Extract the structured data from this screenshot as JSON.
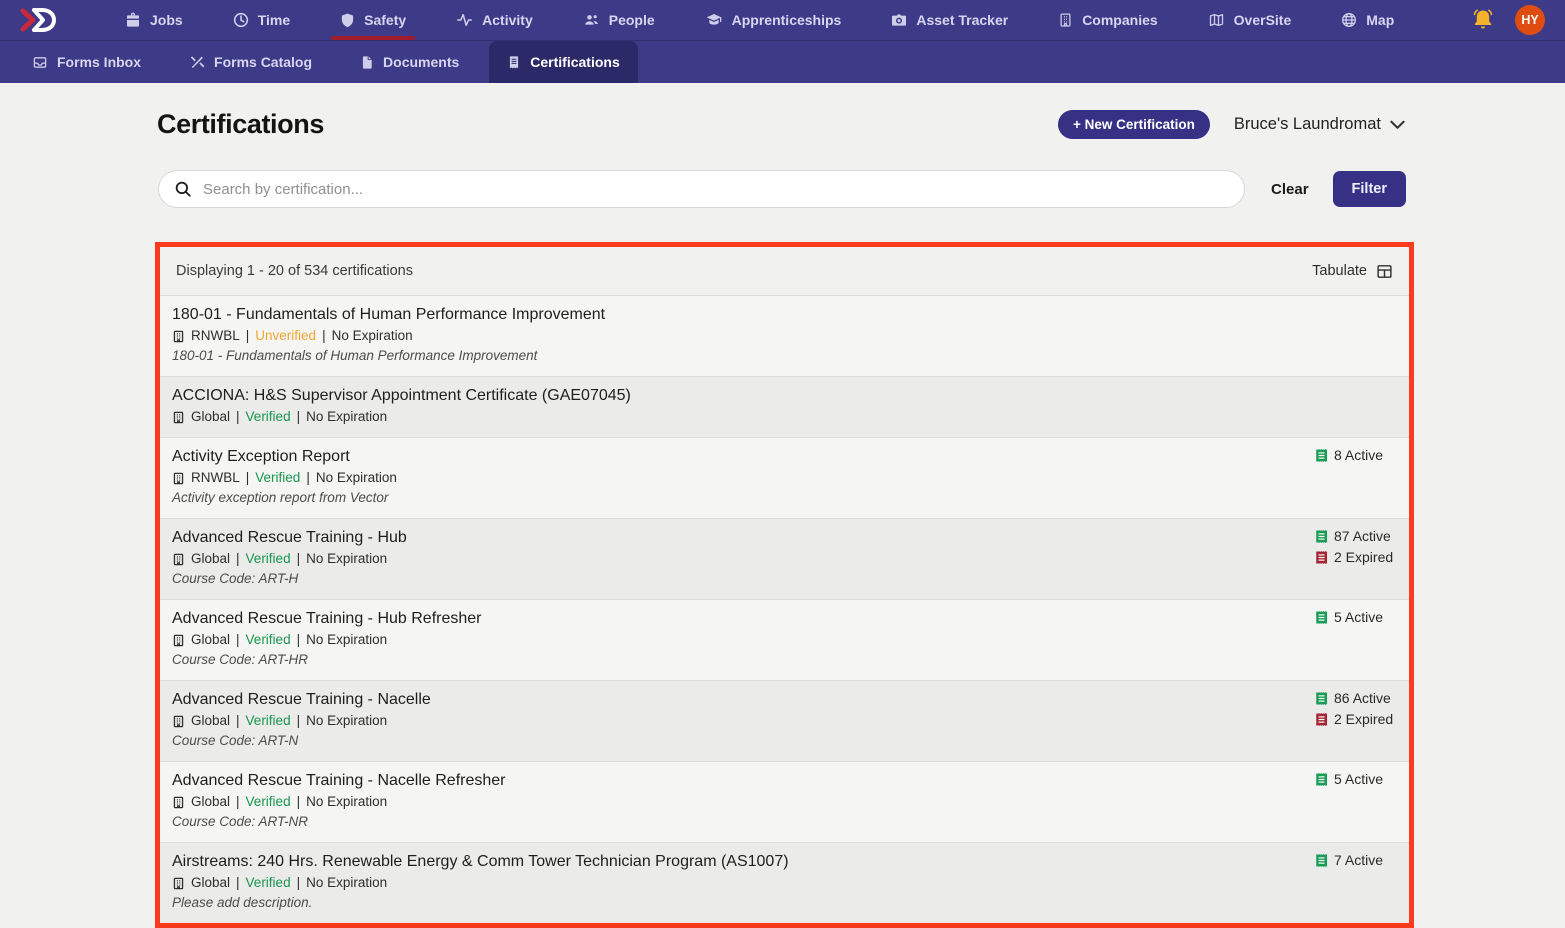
{
  "brand": {
    "logo": "arrow-d-logo"
  },
  "top_nav": {
    "items": [
      {
        "label": "Jobs",
        "icon": "briefcase-icon",
        "active": false
      },
      {
        "label": "Time",
        "icon": "clock-icon",
        "active": false
      },
      {
        "label": "Safety",
        "icon": "shield-icon",
        "active": true
      },
      {
        "label": "Activity",
        "icon": "pulse-icon",
        "active": false
      },
      {
        "label": "People",
        "icon": "people-icon",
        "active": false
      },
      {
        "label": "Apprenticeships",
        "icon": "graduation-cap-icon",
        "active": false
      },
      {
        "label": "Asset Tracker",
        "icon": "camera-icon",
        "active": false
      },
      {
        "label": "Companies",
        "icon": "building-icon",
        "active": false
      },
      {
        "label": "OverSite",
        "icon": "map-icon",
        "active": false
      },
      {
        "label": "Map",
        "icon": "globe-icon",
        "active": false
      }
    ],
    "avatar_initials": "HY"
  },
  "sub_nav": {
    "items": [
      {
        "label": "Forms Inbox",
        "icon": "inbox-icon",
        "active": false
      },
      {
        "label": "Forms Catalog",
        "icon": "tools-icon",
        "active": false
      },
      {
        "label": "Documents",
        "icon": "document-icon",
        "active": false
      },
      {
        "label": "Certifications",
        "icon": "certificate-icon",
        "active": true
      }
    ]
  },
  "page": {
    "title": "Certifications",
    "new_button_label": "+ New Certification",
    "company_selector": "Bruce's Laundromat"
  },
  "search": {
    "placeholder": "Search by certification...",
    "clear_label": "Clear",
    "filter_label": "Filter"
  },
  "list": {
    "summary": "Displaying 1 - 20 of 534 certifications",
    "tabulate_label": "Tabulate",
    "meta_separator": "|",
    "rows": [
      {
        "title": "180-01 - Fundamentals of Human Performance Improvement",
        "scope": "RNWBL",
        "status": "Unverified",
        "expiration": "No Expiration",
        "description": "180-01 - Fundamentals of Human Performance Improvement",
        "counts": []
      },
      {
        "title": "ACCIONA: H&S Supervisor Appointment Certificate (GAE07045)",
        "scope": "Global",
        "status": "Verified",
        "expiration": "No Expiration",
        "description": null,
        "counts": []
      },
      {
        "title": "Activity Exception Report",
        "scope": "RNWBL",
        "status": "Verified",
        "expiration": "No Expiration",
        "description": "Activity exception report from Vector",
        "counts": [
          {
            "kind": "active",
            "text": "8 Active"
          }
        ]
      },
      {
        "title": "Advanced Rescue Training - Hub",
        "scope": "Global",
        "status": "Verified",
        "expiration": "No Expiration",
        "description": "Course Code: ART-H",
        "counts": [
          {
            "kind": "active",
            "text": "87 Active"
          },
          {
            "kind": "expired",
            "text": "2 Expired"
          }
        ]
      },
      {
        "title": "Advanced Rescue Training - Hub Refresher",
        "scope": "Global",
        "status": "Verified",
        "expiration": "No Expiration",
        "description": "Course Code: ART-HR",
        "counts": [
          {
            "kind": "active",
            "text": "5 Active"
          }
        ]
      },
      {
        "title": "Advanced Rescue Training - Nacelle",
        "scope": "Global",
        "status": "Verified",
        "expiration": "No Expiration",
        "description": "Course Code: ART-N",
        "counts": [
          {
            "kind": "active",
            "text": "86 Active"
          },
          {
            "kind": "expired",
            "text": "2 Expired"
          }
        ]
      },
      {
        "title": "Advanced Rescue Training - Nacelle Refresher",
        "scope": "Global",
        "status": "Verified",
        "expiration": "No Expiration",
        "description": "Course Code: ART-NR",
        "counts": [
          {
            "kind": "active",
            "text": "5 Active"
          }
        ]
      },
      {
        "title": "Airstreams: 240 Hrs. Renewable Energy & Comm Tower Technician Program (AS1007)",
        "scope": "Global",
        "status": "Verified",
        "expiration": "No Expiration",
        "description": "Please add description.",
        "counts": [
          {
            "kind": "active",
            "text": "7 Active"
          }
        ]
      }
    ]
  },
  "colors": {
    "nav_bg": "#3d3a87",
    "nav_active_tab_bg": "#2c2968",
    "safety_underline_red": "#a11d2d",
    "accent_navy": "#363185",
    "verified_green": "#17964f",
    "unverified_amber": "#f0a532",
    "active_icon_green": "#1a9b57",
    "expired_icon_red": "#a32533",
    "highlight_border_red": "#fb3a1e",
    "bell_yellow": "#f3b229",
    "avatar_orange": "#df4c0f"
  }
}
